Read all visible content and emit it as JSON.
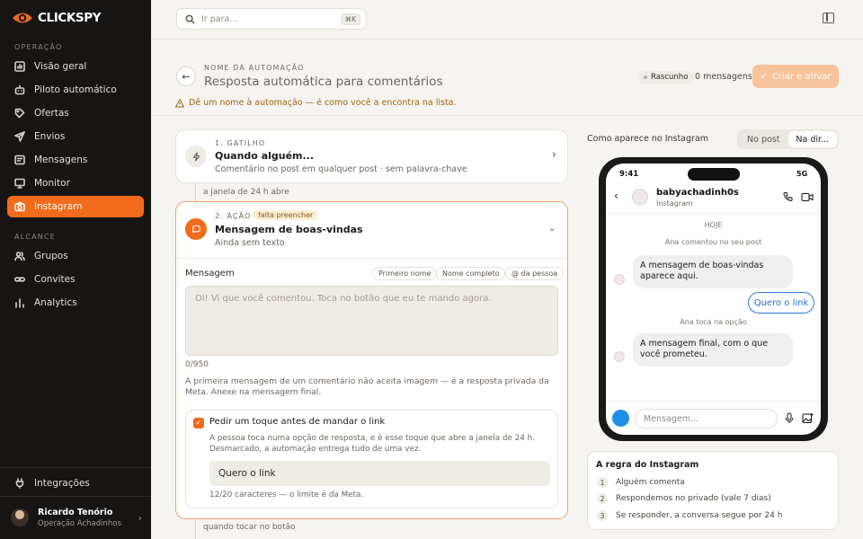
{
  "brand": {
    "name": "CLICKSPY",
    "accent": "#f26a1b"
  },
  "sidebar": {
    "section_ops": "OPERAÇÃO",
    "section_reach": "ALCANCE",
    "items": [
      {
        "label": "Visão geral",
        "icon": "dashboard-icon"
      },
      {
        "label": "Piloto automático",
        "icon": "robot-icon"
      },
      {
        "label": "Ofertas",
        "icon": "tag-icon"
      },
      {
        "label": "Envios",
        "icon": "send-icon"
      },
      {
        "label": "Mensagens",
        "icon": "message-icon"
      },
      {
        "label": "Monitor",
        "icon": "monitor-icon"
      },
      {
        "label": "Instagram",
        "icon": "camera-icon",
        "active": true
      }
    ],
    "reach_items": [
      {
        "label": "Grupos",
        "icon": "users-icon"
      },
      {
        "label": "Convites",
        "icon": "link-icon"
      },
      {
        "label": "Analytics",
        "icon": "bar-chart-icon"
      }
    ],
    "integrations": "Integrações",
    "user": {
      "name": "Ricardo Tenório",
      "org": "Operação Achadinhos"
    }
  },
  "topbar": {
    "search_placeholder": "Ir para...",
    "shortcut": "⌘K"
  },
  "header": {
    "name_label": "NOME DA AUTOMAÇÃO",
    "name_title": "Resposta automática para comentários",
    "warning": "Dê um nome à automação — é como você a encontra na lista.",
    "status": "Rascunho",
    "messages": "0 mensagens",
    "create": "Criar e ativar"
  },
  "trigger": {
    "step": "1. GATILHO",
    "title": "Quando alguém...",
    "subtitle": "Comentário no post em qualquer post · sem palavra-chave"
  },
  "connector1": "a janela de 24 h abre",
  "action": {
    "step": "2. AÇÃO",
    "badge": "falta preencher",
    "title": "Mensagem de boas-vindas",
    "subtitle": "Ainda sem texto",
    "message_label": "Mensagem",
    "chips": [
      "Primeiro nome",
      "Nome completo",
      "@ da pessoa"
    ],
    "placeholder": "Oi! Vi que você comentou. Toca no botão que eu te mando agora.",
    "counter": "0/950",
    "note": "A primeira mensagem de um comentário não aceita imagem — é a resposta privada da Meta. Anexe na mensagem final.",
    "tap_label": "Pedir um toque antes de mandar o link",
    "tap_note": "A pessoa toca numa opção de resposta, e é esse toque que abre a janela de 24 h. Desmarcado, a automação entrega tudo de uma vez.",
    "button_value": "Quero o link",
    "button_counter": "12/20 caracteres — o limite é da Meta."
  },
  "connector2": "quando tocar no botão",
  "preview": {
    "label": "Como aparece no Instagram",
    "tabs": [
      "No post",
      "Na dir..."
    ],
    "time": "9:41",
    "network": "5G",
    "account": "babyachadinh0s",
    "platform": "Instagram",
    "today": "HOJE",
    "event1": "Ana comentou no seu post",
    "bubble1": "A mensagem de boas-vindas aparece aqui.",
    "quick_reply": "Quero o link",
    "event2": "Ana toca na opção",
    "bubble2": "A mensagem final, com o que você prometeu.",
    "input_placeholder": "Mensagem..."
  },
  "rules": {
    "title": "A regra do Instagram",
    "items": [
      {
        "num": "1",
        "text": "Alguém comenta"
      },
      {
        "num": "2",
        "text": "Respondemos no privado (vale 7 dias)"
      },
      {
        "num": "3",
        "text": "Se responder, a conversa segue por 24 h"
      }
    ]
  }
}
